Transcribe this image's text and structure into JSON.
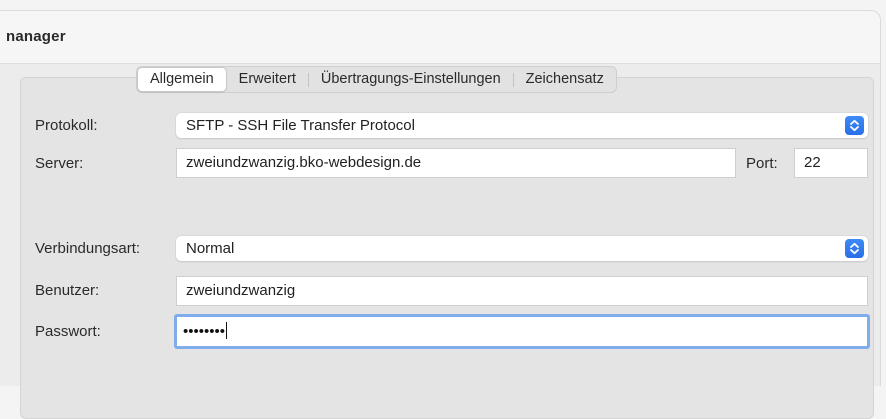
{
  "window": {
    "title": "nanager"
  },
  "tabs": [
    {
      "label": "Allgemein",
      "active": true
    },
    {
      "label": "Erweitert",
      "active": false
    },
    {
      "label": "Übertragungs-Einstellungen",
      "active": false
    },
    {
      "label": "Zeichensatz",
      "active": false
    }
  ],
  "form": {
    "protocol_label": "Protokoll:",
    "protocol_value": "SFTP - SSH File Transfer Protocol",
    "server_label": "Server:",
    "server_value": "zweiundzwanzig.bko-webdesign.de",
    "port_label": "Port:",
    "port_value": "22",
    "connection_type_label": "Verbindungsart:",
    "connection_type_value": "Normal",
    "user_label": "Benutzer:",
    "user_value": "zweiundzwanzig",
    "password_label": "Passwort:",
    "password_masked": "••••••••"
  },
  "colors": {
    "accent": "#2a6ee8",
    "focus_ring": "#7fadec"
  },
  "icons": {
    "select_arrow": "chevron-up-down-icon"
  }
}
